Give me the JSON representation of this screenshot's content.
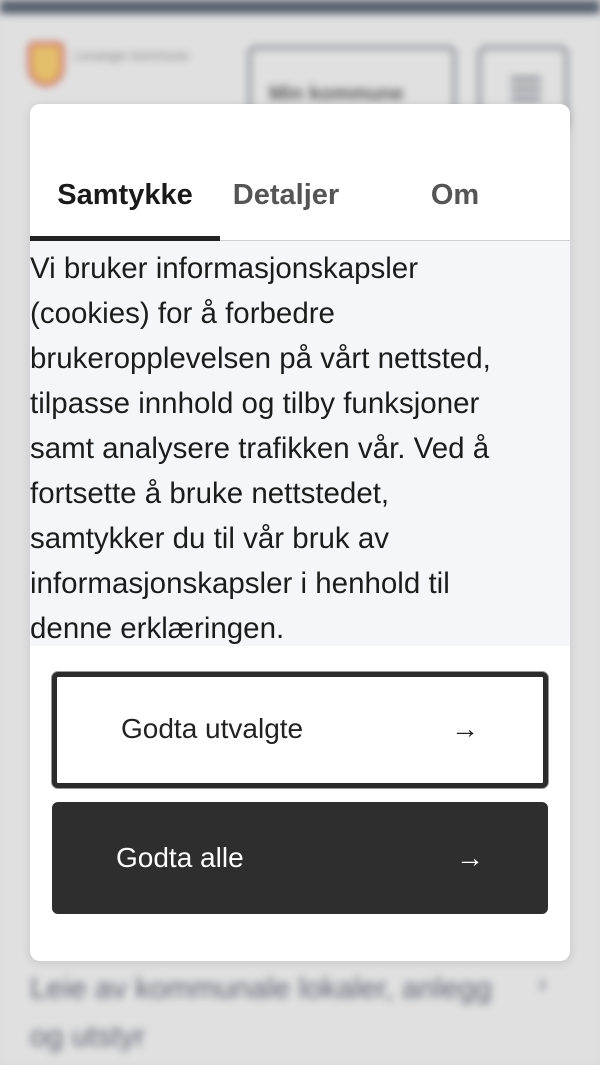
{
  "background": {
    "logo_text": "Levanger kommune",
    "my_kommune_label": "Min kommune",
    "link_text": "Leie av kommunale lokaler, anlegg og utstyr"
  },
  "dialog": {
    "tabs": [
      {
        "label": "Samtykke",
        "active": true
      },
      {
        "label": "Detaljer",
        "active": false
      },
      {
        "label": "Om",
        "active": false
      }
    ],
    "body_text": "Vi bruker informasjonskapsler\n(cookies) for å forbedre\nbrukeropplevelsen på vårt nettsted,\ntilpasse innhold og tilby funksjoner\nsamt analysere trafikken vår. Ved å\nfortsette å bruke nettstedet,\nsamtykker du til vår bruk av\ninformasjonskapsler i henhold til\ndenne erklæringen.",
    "buttons": {
      "accept_selected": "Godta utvalgte",
      "accept_all": "Godta alle",
      "arrow_icon": "arrow-right-icon"
    }
  },
  "colors": {
    "primary_dark": "#2e2e2e",
    "text_area_bg": "#f4f6fa",
    "header_bar": "#2f3b50"
  }
}
